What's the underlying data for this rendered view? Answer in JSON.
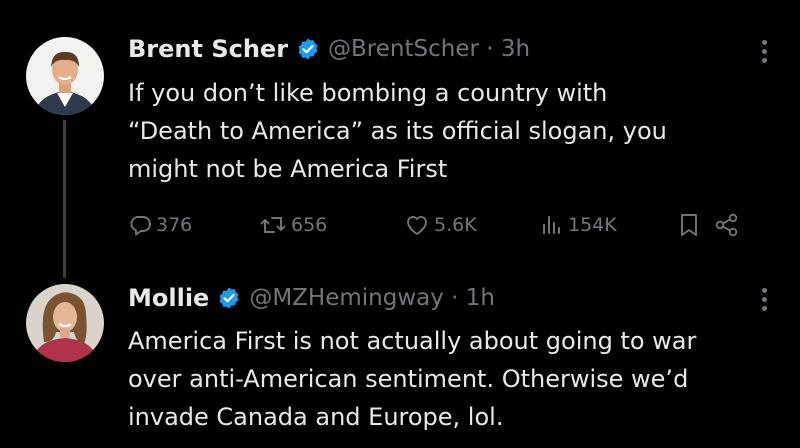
{
  "tweets": [
    {
      "name": "Brent Scher",
      "handle_line": "@BrentScher · 3h",
      "verified_icon": "verified-badge-icon",
      "lines": [
        "If you don’t like bombing a country with",
        "“Death to America” as its official slogan, you",
        "might not be America First"
      ],
      "actions": {
        "replies": "376",
        "reposts": "656",
        "likes": "5.6K",
        "views": "154K"
      },
      "action_icons": [
        "reply-icon",
        "repost-icon",
        "like-icon",
        "views-icon",
        "bookmark-icon",
        "share-icon"
      ]
    },
    {
      "name": "Mollie",
      "handle_line": "@MZHemingway · 1h",
      "verified_icon": "verified-badge-icon",
      "lines": [
        "America First is not actually about going to war",
        "over anti-American sentiment. Otherwise we’d",
        "invade Canada and Europe, lol."
      ]
    }
  ],
  "colors": {
    "background": "#000000",
    "text": "#e7e9ea",
    "secondary": "#71767b",
    "verified": "#1d9bf0",
    "thread_line": "#3e4144"
  }
}
